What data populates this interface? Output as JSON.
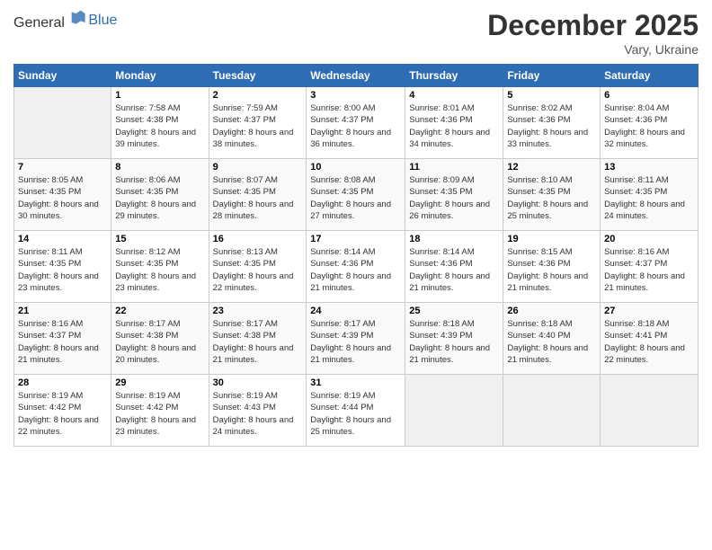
{
  "logo": {
    "general": "General",
    "blue": "Blue"
  },
  "header": {
    "month": "December 2025",
    "location": "Vary, Ukraine"
  },
  "days_of_week": [
    "Sunday",
    "Monday",
    "Tuesday",
    "Wednesday",
    "Thursday",
    "Friday",
    "Saturday"
  ],
  "weeks": [
    [
      {
        "num": "",
        "empty": true
      },
      {
        "num": "1",
        "sunrise": "7:58 AM",
        "sunset": "4:38 PM",
        "daylight": "8 hours and 39 minutes."
      },
      {
        "num": "2",
        "sunrise": "7:59 AM",
        "sunset": "4:37 PM",
        "daylight": "8 hours and 38 minutes."
      },
      {
        "num": "3",
        "sunrise": "8:00 AM",
        "sunset": "4:37 PM",
        "daylight": "8 hours and 36 minutes."
      },
      {
        "num": "4",
        "sunrise": "8:01 AM",
        "sunset": "4:36 PM",
        "daylight": "8 hours and 34 minutes."
      },
      {
        "num": "5",
        "sunrise": "8:02 AM",
        "sunset": "4:36 PM",
        "daylight": "8 hours and 33 minutes."
      },
      {
        "num": "6",
        "sunrise": "8:04 AM",
        "sunset": "4:36 PM",
        "daylight": "8 hours and 32 minutes."
      }
    ],
    [
      {
        "num": "7",
        "sunrise": "8:05 AM",
        "sunset": "4:35 PM",
        "daylight": "8 hours and 30 minutes."
      },
      {
        "num": "8",
        "sunrise": "8:06 AM",
        "sunset": "4:35 PM",
        "daylight": "8 hours and 29 minutes."
      },
      {
        "num": "9",
        "sunrise": "8:07 AM",
        "sunset": "4:35 PM",
        "daylight": "8 hours and 28 minutes."
      },
      {
        "num": "10",
        "sunrise": "8:08 AM",
        "sunset": "4:35 PM",
        "daylight": "8 hours and 27 minutes."
      },
      {
        "num": "11",
        "sunrise": "8:09 AM",
        "sunset": "4:35 PM",
        "daylight": "8 hours and 26 minutes."
      },
      {
        "num": "12",
        "sunrise": "8:10 AM",
        "sunset": "4:35 PM",
        "daylight": "8 hours and 25 minutes."
      },
      {
        "num": "13",
        "sunrise": "8:11 AM",
        "sunset": "4:35 PM",
        "daylight": "8 hours and 24 minutes."
      }
    ],
    [
      {
        "num": "14",
        "sunrise": "8:11 AM",
        "sunset": "4:35 PM",
        "daylight": "8 hours and 23 minutes."
      },
      {
        "num": "15",
        "sunrise": "8:12 AM",
        "sunset": "4:35 PM",
        "daylight": "8 hours and 23 minutes."
      },
      {
        "num": "16",
        "sunrise": "8:13 AM",
        "sunset": "4:35 PM",
        "daylight": "8 hours and 22 minutes."
      },
      {
        "num": "17",
        "sunrise": "8:14 AM",
        "sunset": "4:36 PM",
        "daylight": "8 hours and 21 minutes."
      },
      {
        "num": "18",
        "sunrise": "8:14 AM",
        "sunset": "4:36 PM",
        "daylight": "8 hours and 21 minutes."
      },
      {
        "num": "19",
        "sunrise": "8:15 AM",
        "sunset": "4:36 PM",
        "daylight": "8 hours and 21 minutes."
      },
      {
        "num": "20",
        "sunrise": "8:16 AM",
        "sunset": "4:37 PM",
        "daylight": "8 hours and 21 minutes."
      }
    ],
    [
      {
        "num": "21",
        "sunrise": "8:16 AM",
        "sunset": "4:37 PM",
        "daylight": "8 hours and 21 minutes."
      },
      {
        "num": "22",
        "sunrise": "8:17 AM",
        "sunset": "4:38 PM",
        "daylight": "8 hours and 20 minutes."
      },
      {
        "num": "23",
        "sunrise": "8:17 AM",
        "sunset": "4:38 PM",
        "daylight": "8 hours and 21 minutes."
      },
      {
        "num": "24",
        "sunrise": "8:17 AM",
        "sunset": "4:39 PM",
        "daylight": "8 hours and 21 minutes."
      },
      {
        "num": "25",
        "sunrise": "8:18 AM",
        "sunset": "4:39 PM",
        "daylight": "8 hours and 21 minutes."
      },
      {
        "num": "26",
        "sunrise": "8:18 AM",
        "sunset": "4:40 PM",
        "daylight": "8 hours and 21 minutes."
      },
      {
        "num": "27",
        "sunrise": "8:18 AM",
        "sunset": "4:41 PM",
        "daylight": "8 hours and 22 minutes."
      }
    ],
    [
      {
        "num": "28",
        "sunrise": "8:19 AM",
        "sunset": "4:42 PM",
        "daylight": "8 hours and 22 minutes."
      },
      {
        "num": "29",
        "sunrise": "8:19 AM",
        "sunset": "4:42 PM",
        "daylight": "8 hours and 23 minutes."
      },
      {
        "num": "30",
        "sunrise": "8:19 AM",
        "sunset": "4:43 PM",
        "daylight": "8 hours and 24 minutes."
      },
      {
        "num": "31",
        "sunrise": "8:19 AM",
        "sunset": "4:44 PM",
        "daylight": "8 hours and 25 minutes."
      },
      {
        "num": "",
        "empty": true
      },
      {
        "num": "",
        "empty": true
      },
      {
        "num": "",
        "empty": true
      }
    ]
  ]
}
